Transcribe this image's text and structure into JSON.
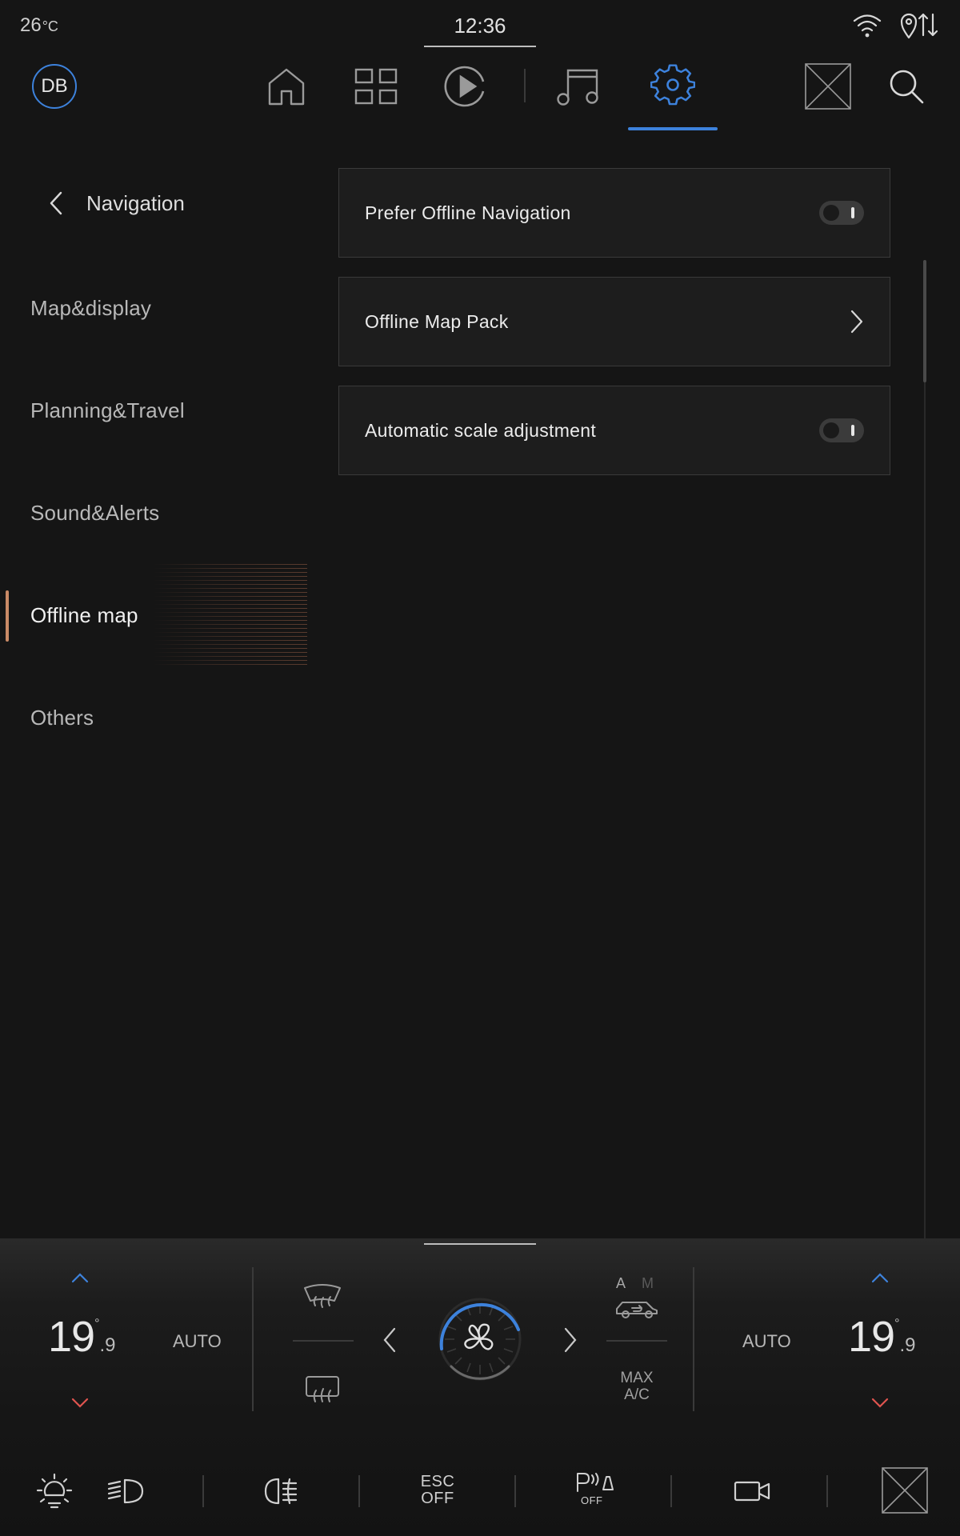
{
  "status": {
    "temperature": "26",
    "temperature_unit": "°C",
    "time": "12:36",
    "icons": [
      "wifi-icon",
      "location-data-icon"
    ]
  },
  "topnav": {
    "avatar_initials": "DB",
    "items": [
      {
        "name": "home-icon"
      },
      {
        "name": "apps-grid-icon"
      },
      {
        "name": "play-icon"
      },
      {
        "name": "music-note-icon"
      },
      {
        "name": "settings-gear-icon",
        "active": true
      },
      {
        "name": "image-placeholder-icon"
      },
      {
        "name": "search-icon"
      }
    ],
    "accent": "#3d82dc"
  },
  "sidebar": {
    "back_title": "Navigation",
    "items": [
      {
        "label": "Map&display"
      },
      {
        "label": "Planning&Travel"
      },
      {
        "label": "Sound&Alerts"
      },
      {
        "label": "Offline map",
        "active": true
      },
      {
        "label": "Others"
      }
    ],
    "active_color": "#c98a66"
  },
  "settings": {
    "rows": [
      {
        "label": "Prefer Offline Navigation",
        "control": "toggle",
        "state": "off"
      },
      {
        "label": "Offline Map Pack",
        "control": "chevron"
      },
      {
        "label": "Automatic scale adjustment",
        "control": "toggle",
        "state": "off"
      }
    ]
  },
  "climate": {
    "left_temp": "19",
    "left_temp_decimal": ".9",
    "left_mode": "AUTO",
    "right_temp": "19",
    "right_temp_decimal": ".9",
    "right_mode": "AUTO",
    "temp_degree": "°",
    "recirc_modes": [
      "A",
      "M"
    ],
    "max_ac": "MAX\nA/C",
    "up_color": "#3d82dc",
    "down_color": "#e0544f"
  },
  "quickbar": {
    "esc_label": "ESC\nOFF",
    "park_label": "OFF"
  }
}
